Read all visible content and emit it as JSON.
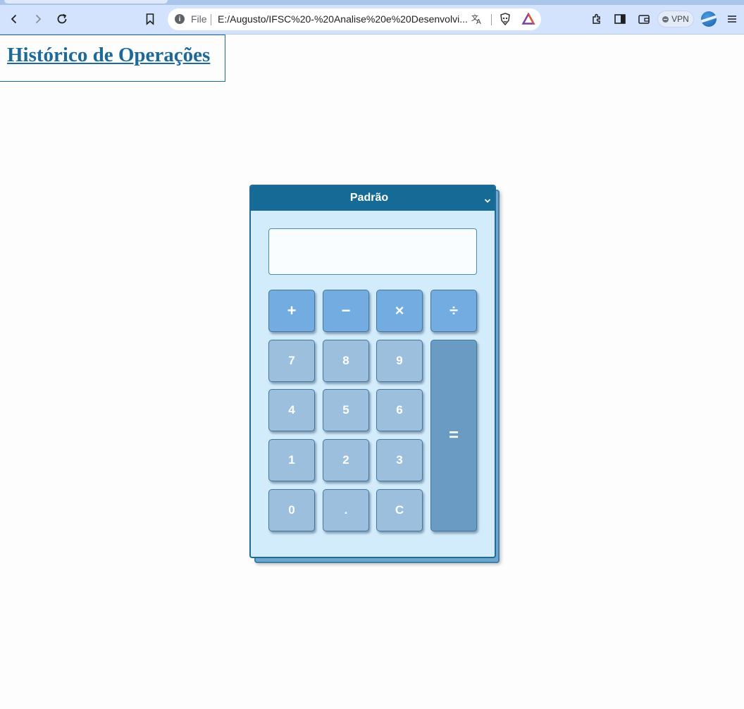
{
  "browser": {
    "address_scheme": "File",
    "address_url": "E:/Augusto/IFSC%20-%20Analise%20e%20Desenvolvi...",
    "vpn_label": "VPN"
  },
  "page": {
    "history_link": "Histórico de Operações"
  },
  "calculator": {
    "mode": "Padrão",
    "display_value": "",
    "operators": [
      "+",
      "−",
      "×",
      "÷"
    ],
    "digits_row1": [
      "7",
      "8",
      "9"
    ],
    "digits_row2": [
      "4",
      "5",
      "6"
    ],
    "digits_row3": [
      "1",
      "2",
      "3"
    ],
    "bottom_row": [
      "0",
      ".",
      "C"
    ],
    "equals": "="
  }
}
